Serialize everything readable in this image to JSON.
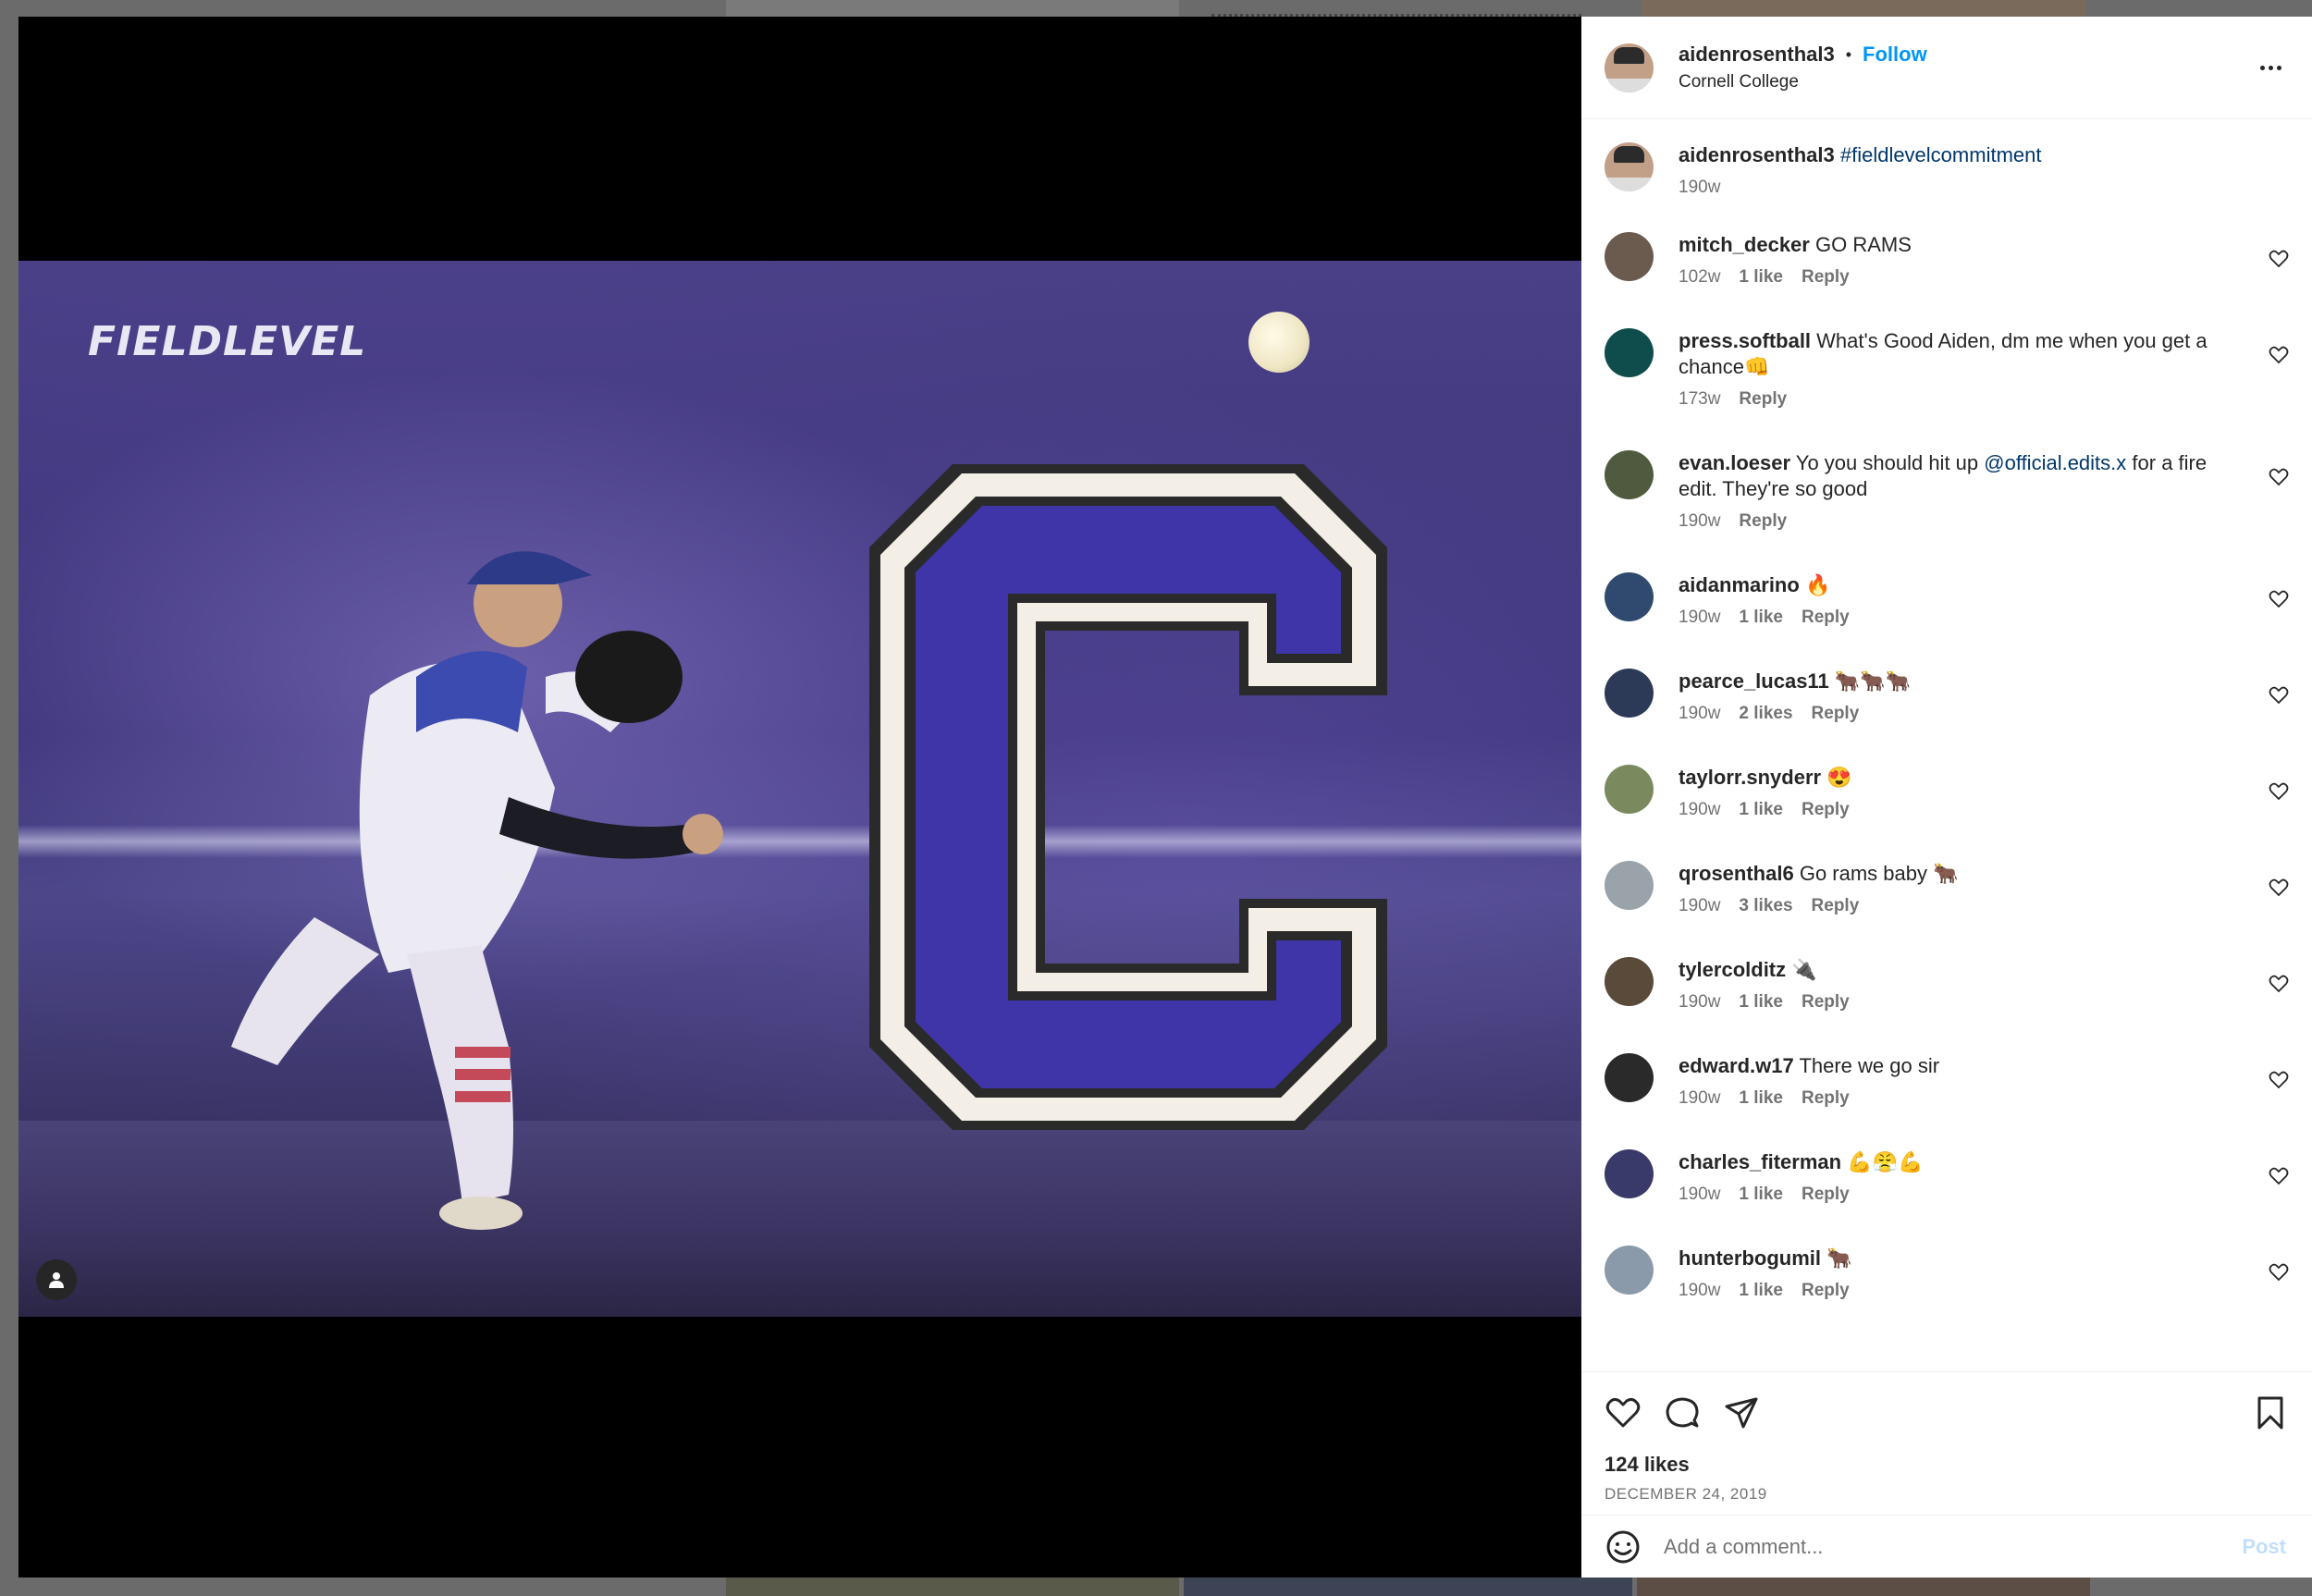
{
  "post": {
    "username": "aidenrosenthal3",
    "follow_label": "Follow",
    "dot": "•",
    "location": "Cornell College",
    "image_logo_text": "FIELDLEVEL",
    "caption": {
      "username": "aidenrosenthal3",
      "text": "#fieldlevelcommitment",
      "time": "190w"
    },
    "likes": "124 likes",
    "date": "DECEMBER 24, 2019",
    "comment_placeholder": "Add a comment...",
    "post_label": "Post"
  },
  "comments": [
    {
      "username": "mitch_decker",
      "text": "GO RAMS",
      "time": "102w",
      "likes": "1 like",
      "reply": "Reply",
      "avatar_color": "#6b5a4e"
    },
    {
      "username": "press.softball",
      "text": "What's Good Aiden, dm me when you get a chance👊",
      "time": "173w",
      "likes": "",
      "reply": "Reply",
      "avatar_color": "#0f4c4c"
    },
    {
      "username": "evan.loeser",
      "text": "Yo you should hit up",
      "mention": "@official.edits.x",
      "text_after": "for a fire edit. They're so good",
      "time": "190w",
      "likes": "",
      "reply": "Reply",
      "avatar_color": "#4f5a3e"
    },
    {
      "username": "aidanmarino",
      "text": "🔥",
      "time": "190w",
      "likes": "1 like",
      "reply": "Reply",
      "avatar_color": "#2f4a6e"
    },
    {
      "username": "pearce_lucas11",
      "text": "🐂🐂🐂",
      "time": "190w",
      "likes": "2 likes",
      "reply": "Reply",
      "avatar_color": "#2c3a58"
    },
    {
      "username": "taylorr.snyderr",
      "text": "😍",
      "time": "190w",
      "likes": "1 like",
      "reply": "Reply",
      "avatar_color": "#7a8a5e"
    },
    {
      "username": "qrosenthal6",
      "text": "Go rams baby 🐂",
      "time": "190w",
      "likes": "3 likes",
      "reply": "Reply",
      "avatar_color": "#9aa2aa"
    },
    {
      "username": "tylercolditz",
      "text": "🔌",
      "time": "190w",
      "likes": "1 like",
      "reply": "Reply",
      "avatar_color": "#5a4a3a"
    },
    {
      "username": "edward.w17",
      "text": "There we go sir",
      "time": "190w",
      "likes": "1 like",
      "reply": "Reply",
      "avatar_color": "#2a2a2a"
    },
    {
      "username": "charles_fiterman",
      "text": "💪😤💪",
      "time": "190w",
      "likes": "1 like",
      "reply": "Reply",
      "avatar_color": "#3a3a6a"
    },
    {
      "username": "hunterbogumil",
      "text": "🐂",
      "time": "190w",
      "likes": "1 like",
      "reply": "Reply",
      "avatar_color": "#8a9aaa"
    }
  ],
  "icons": {
    "more": "more-options-icon",
    "like": "heart-icon",
    "comment": "comment-bubble-icon",
    "share": "send-icon",
    "save": "bookmark-icon",
    "emoji": "emoji-icon",
    "tag": "user-tag-icon"
  },
  "colors": {
    "accent": "#0095f6",
    "hashtag": "#00376b",
    "text": "#262626",
    "muted": "#737373",
    "disabled_post": "#c0dffd"
  }
}
